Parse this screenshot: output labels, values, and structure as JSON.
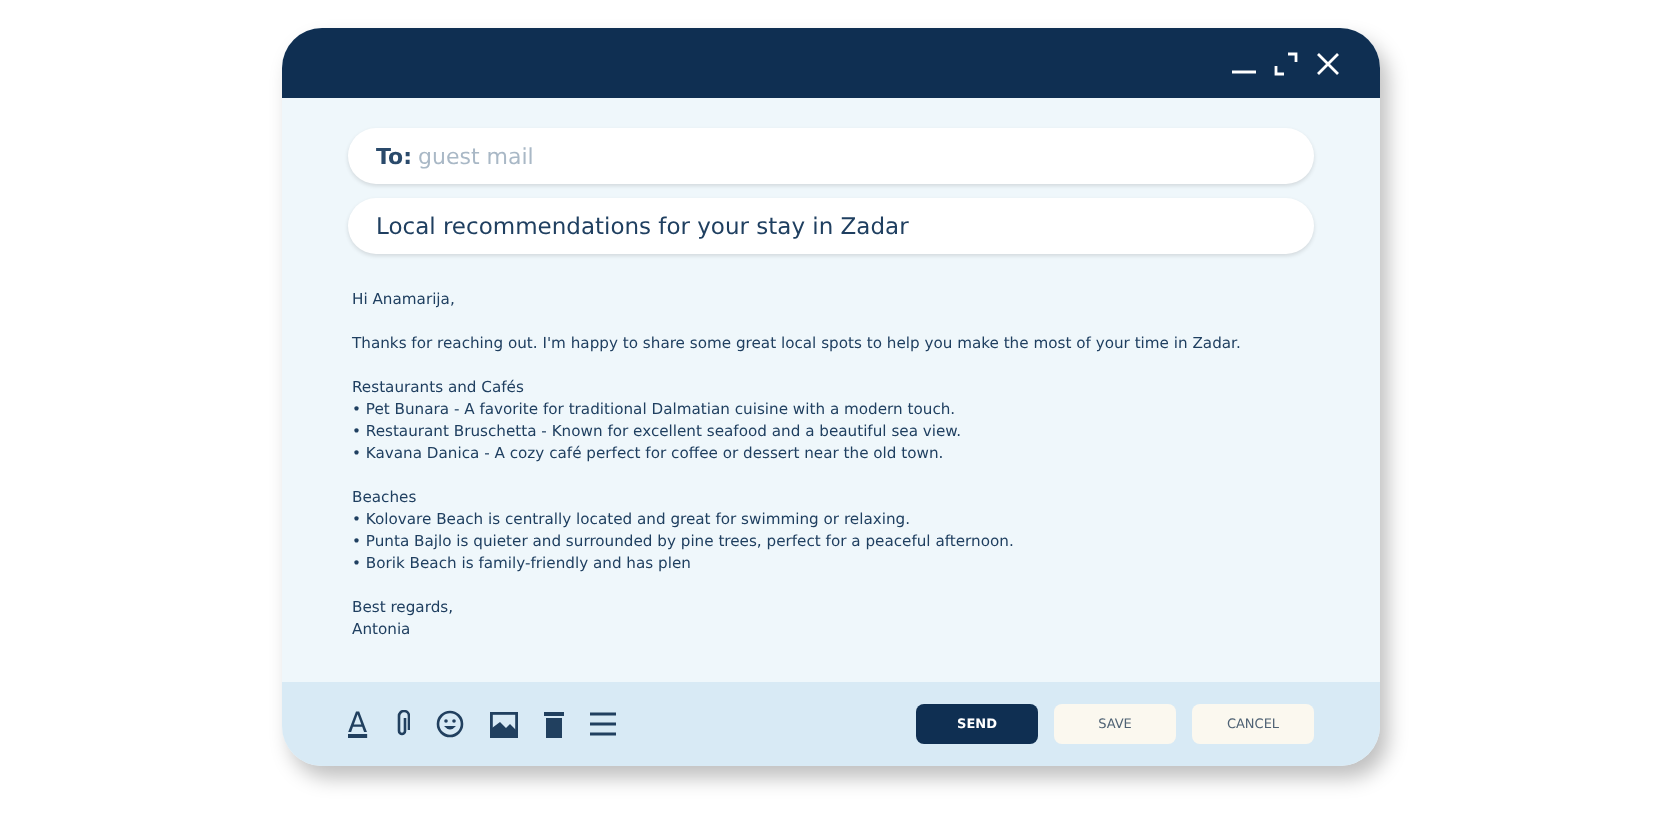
{
  "to_field": {
    "label": "To:",
    "placeholder": "guest mail"
  },
  "subject_field": {
    "value": "Local recommendations for your stay in Zadar"
  },
  "body": [
    [
      "Hi Anamarija,"
    ],
    [
      "Thanks for reaching out. I'm happy to share some great local spots to help you make the most of your time in Zadar."
    ],
    [
      "Restaurants and Cafés",
      "• Pet Bunara - A favorite for traditional Dalmatian cuisine with a modern touch.",
      "• Restaurant Bruschetta - Known for excellent seafood and a beautiful sea view.",
      "• Kavana Danica - A cozy café perfect for coffee or dessert near the old town."
    ],
    [
      "Beaches",
      "• Kolovare Beach is centrally located and great for swimming or relaxing.",
      "• Punta Bajlo is quieter and surrounded by pine trees, perfect for a peaceful afternoon.",
      "• Borik Beach is family-friendly and has plen"
    ],
    [
      "Best regards,",
      "Antonia"
    ]
  ],
  "toolbar": [
    {
      "kind": "text-format",
      "glyph": "A"
    },
    {
      "kind": "attach"
    },
    {
      "kind": "emoji"
    },
    {
      "kind": "image"
    },
    {
      "kind": "delete"
    },
    {
      "kind": "menu"
    }
  ],
  "buttons": [
    {
      "label": "SEND",
      "kind": "primary"
    },
    {
      "label": "SAVE",
      "kind": "secondary"
    },
    {
      "label": "CANCEL",
      "kind": "secondary"
    }
  ]
}
